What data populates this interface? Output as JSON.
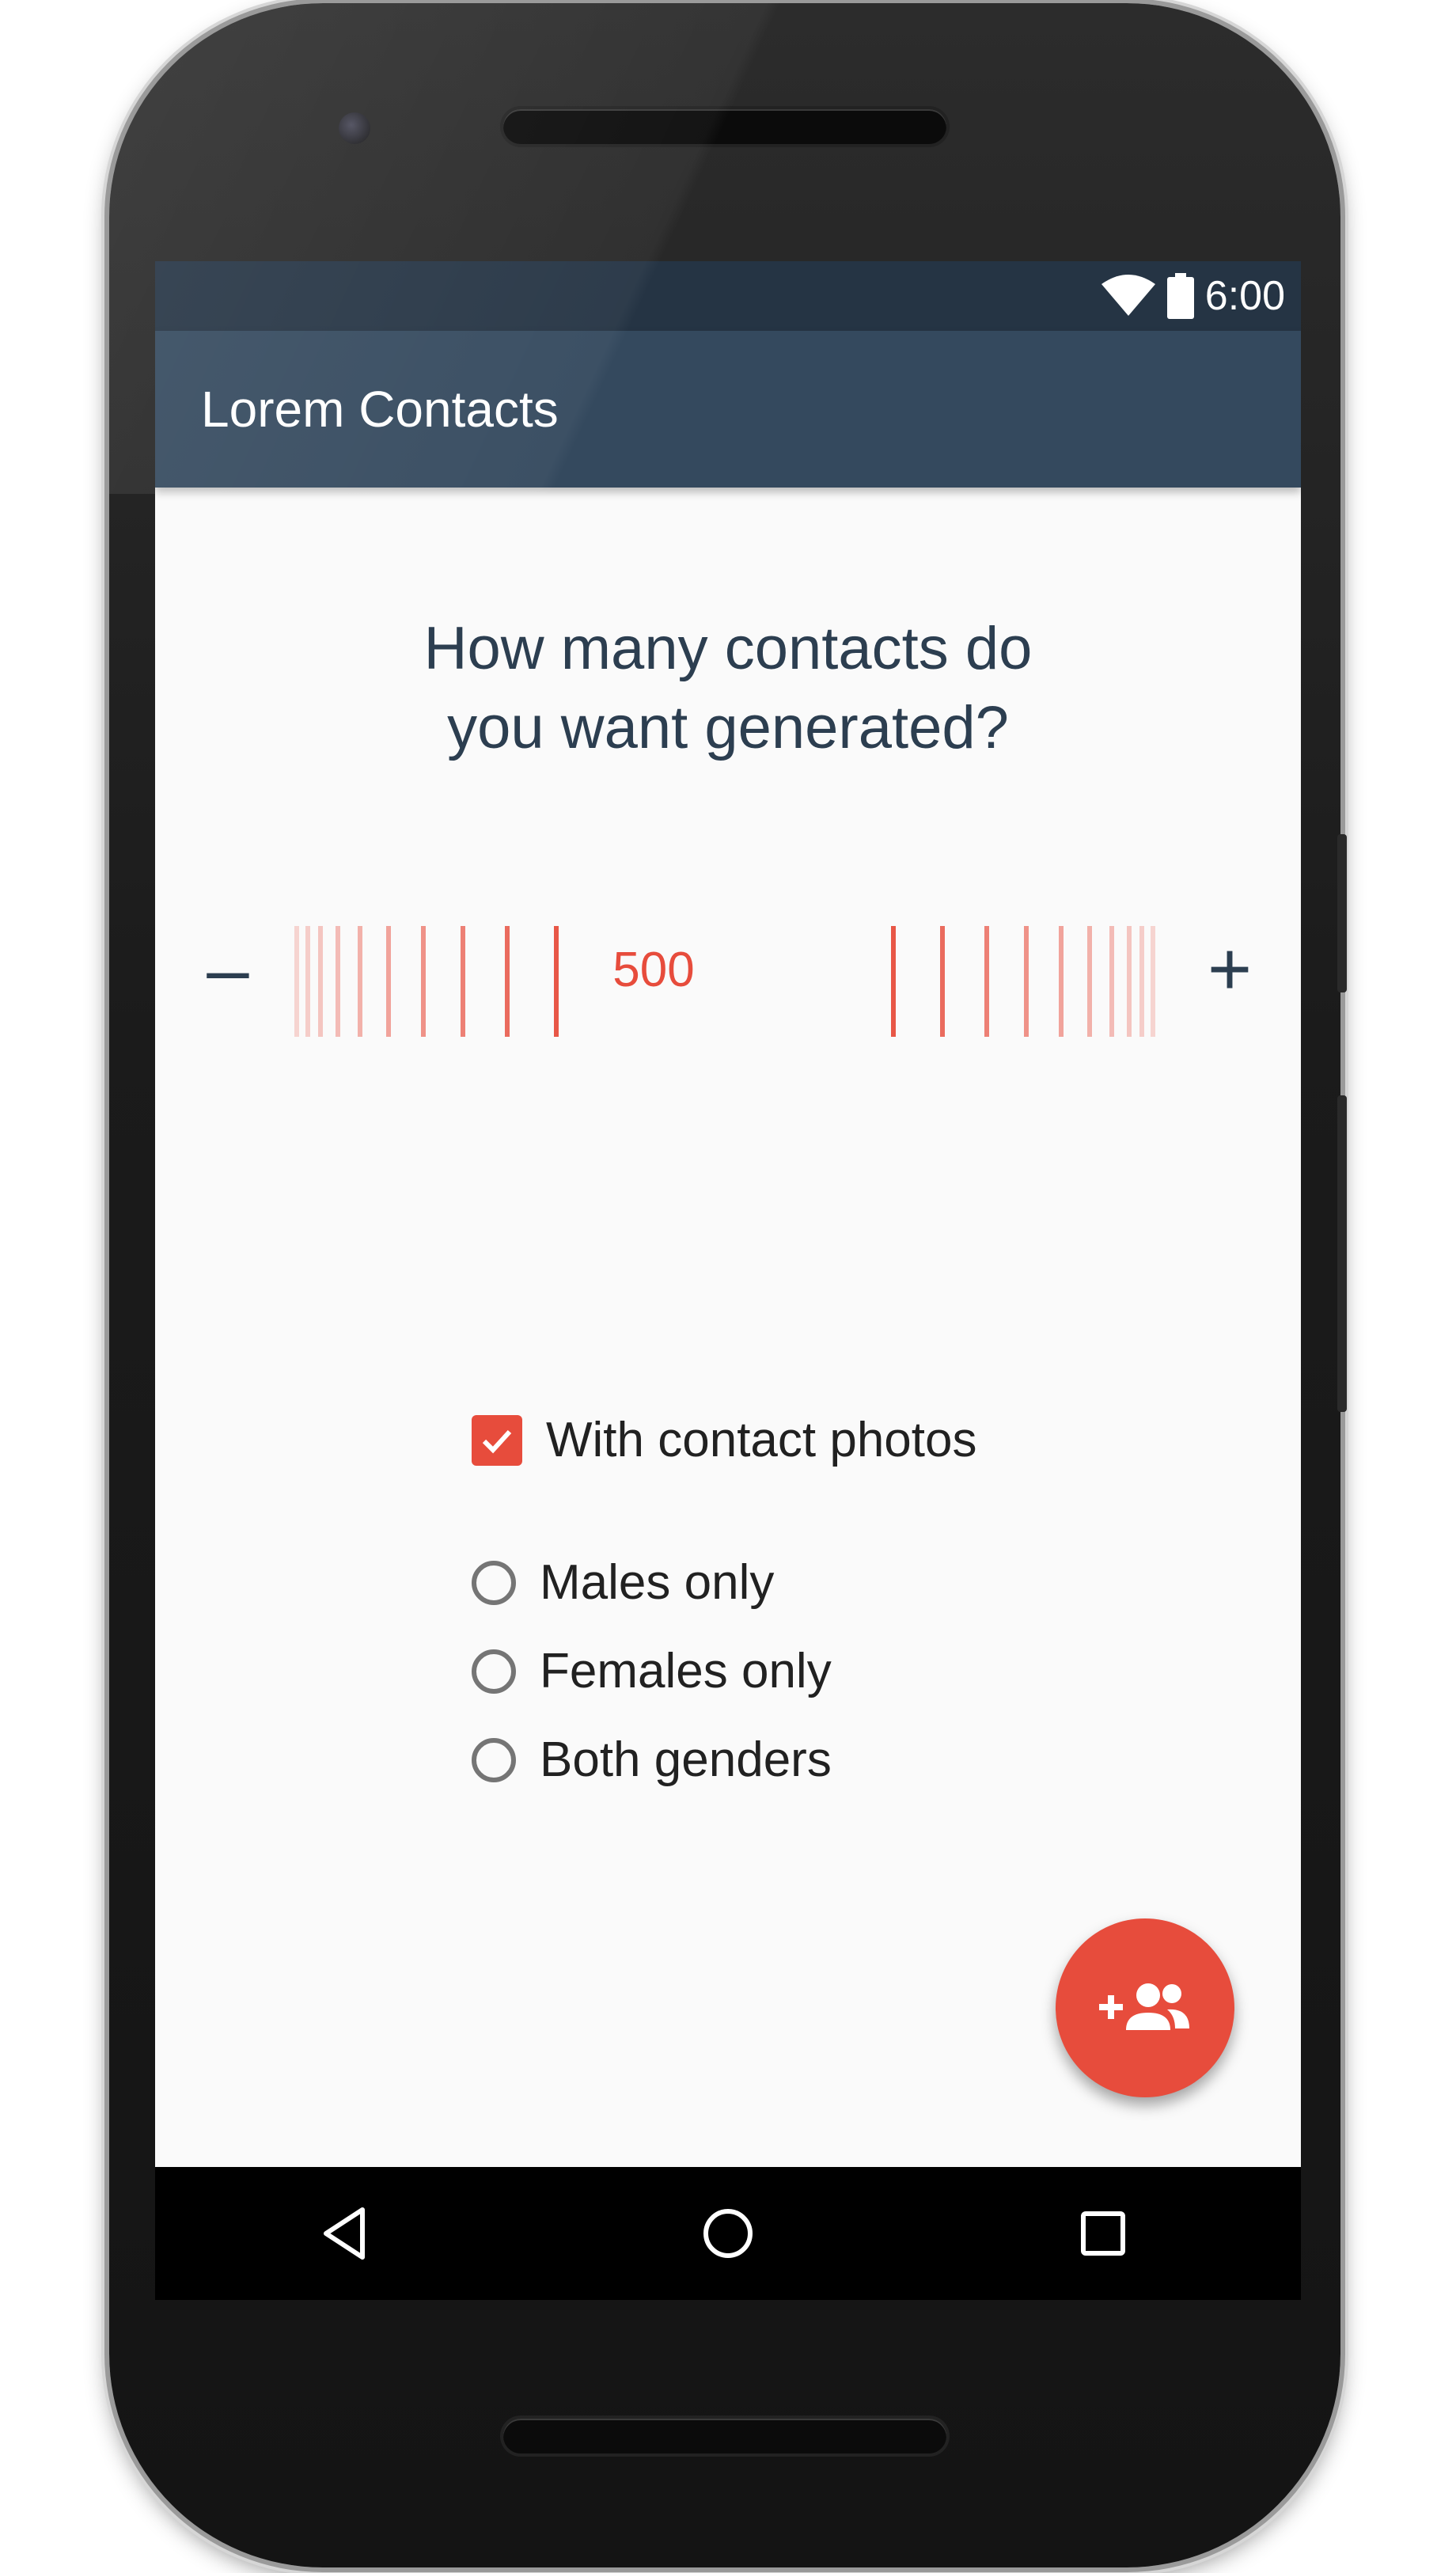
{
  "status_bar": {
    "time": "6:00",
    "icons": [
      "wifi-icon",
      "battery-icon"
    ]
  },
  "app_bar": {
    "title": "Lorem Contacts"
  },
  "main": {
    "question_line1": "How many contacts do",
    "question_line2": "you want generated?",
    "stepper": {
      "decrement_label": "–",
      "increment_label": "+",
      "value": "500"
    },
    "photos_option": {
      "label": "With contact photos",
      "checked": true
    },
    "gender_options": [
      {
        "label": "Males only",
        "selected": false
      },
      {
        "label": "Females only",
        "selected": false
      },
      {
        "label": "Both genders",
        "selected": false
      }
    ],
    "fab_icon": "add-contacts-icon"
  },
  "nav_bar": {
    "icons": [
      "back-icon",
      "home-icon",
      "recents-icon"
    ]
  },
  "colors": {
    "accent": "#e74c3c",
    "app_bar": "#34495e",
    "status_bar": "#253444",
    "text_primary": "#2c3e50"
  }
}
